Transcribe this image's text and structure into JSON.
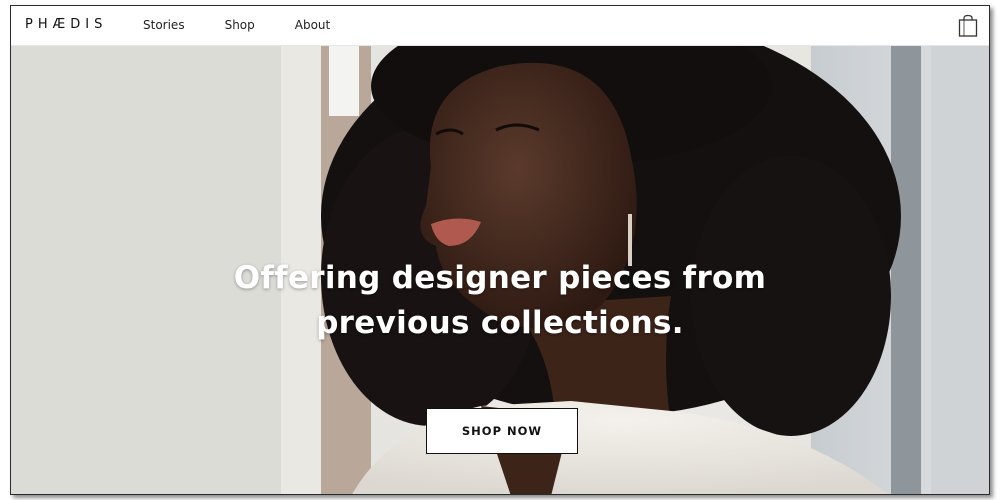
{
  "header": {
    "logo": "PHÆDIS",
    "nav": [
      {
        "label": "Stories"
      },
      {
        "label": "Shop"
      },
      {
        "label": "About"
      }
    ],
    "cart_icon": "shopping-bag-icon"
  },
  "hero": {
    "headline_line1": "Offering designer pieces from",
    "headline_line2": "previous collections.",
    "cta_label": "SHOP NOW"
  },
  "colors": {
    "text": "#111111",
    "headline": "#ffffff",
    "button_bg": "#ffffff",
    "button_border": "#111111"
  }
}
